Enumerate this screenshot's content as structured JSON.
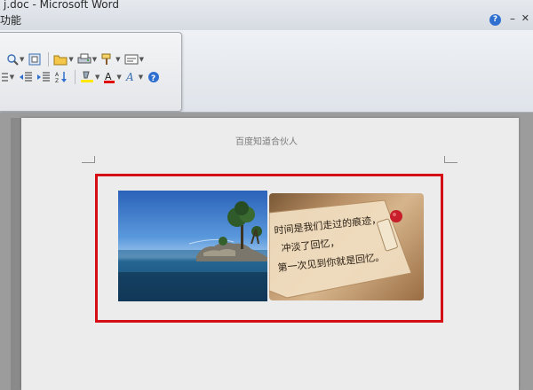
{
  "window": {
    "title": "文档.doc - Microsoft Word",
    "title_visible": "j.doc - Microsoft Word",
    "menu_label": "功能",
    "help_icon": "?"
  },
  "toolbar": {
    "row1": [
      {
        "icon": "zoom-icon"
      },
      {
        "icon": "full-screen-icon"
      },
      {
        "icon": "open-folder-icon"
      },
      {
        "icon": "print-icon"
      },
      {
        "icon": "format-painter-icon"
      },
      {
        "icon": "insert-frame-icon"
      }
    ],
    "row2": [
      {
        "icon": "list-icon"
      },
      {
        "icon": "decrease-indent-icon"
      },
      {
        "icon": "increase-indent-icon"
      },
      {
        "icon": "sort-icon"
      },
      {
        "icon": "highlight-icon"
      },
      {
        "icon": "font-color-icon",
        "label": "A"
      },
      {
        "icon": "text-effect-icon",
        "label": "A"
      },
      {
        "icon": "help-circle-icon"
      }
    ],
    "colors": {
      "highlight": "#ffe800",
      "font_color": "#e00000",
      "accent": "#2f6fd0"
    }
  },
  "document": {
    "header_text": "百度知道合伙人",
    "frame_color": "#d40e14",
    "images": [
      {
        "name": "island-sea-photo"
      },
      {
        "name": "handwritten-note-photo",
        "text_lines": [
          "时间是我们走过的痕迹，",
          "冲淡了回忆，",
          "第一次见到你就是回忆。"
        ]
      }
    ]
  }
}
